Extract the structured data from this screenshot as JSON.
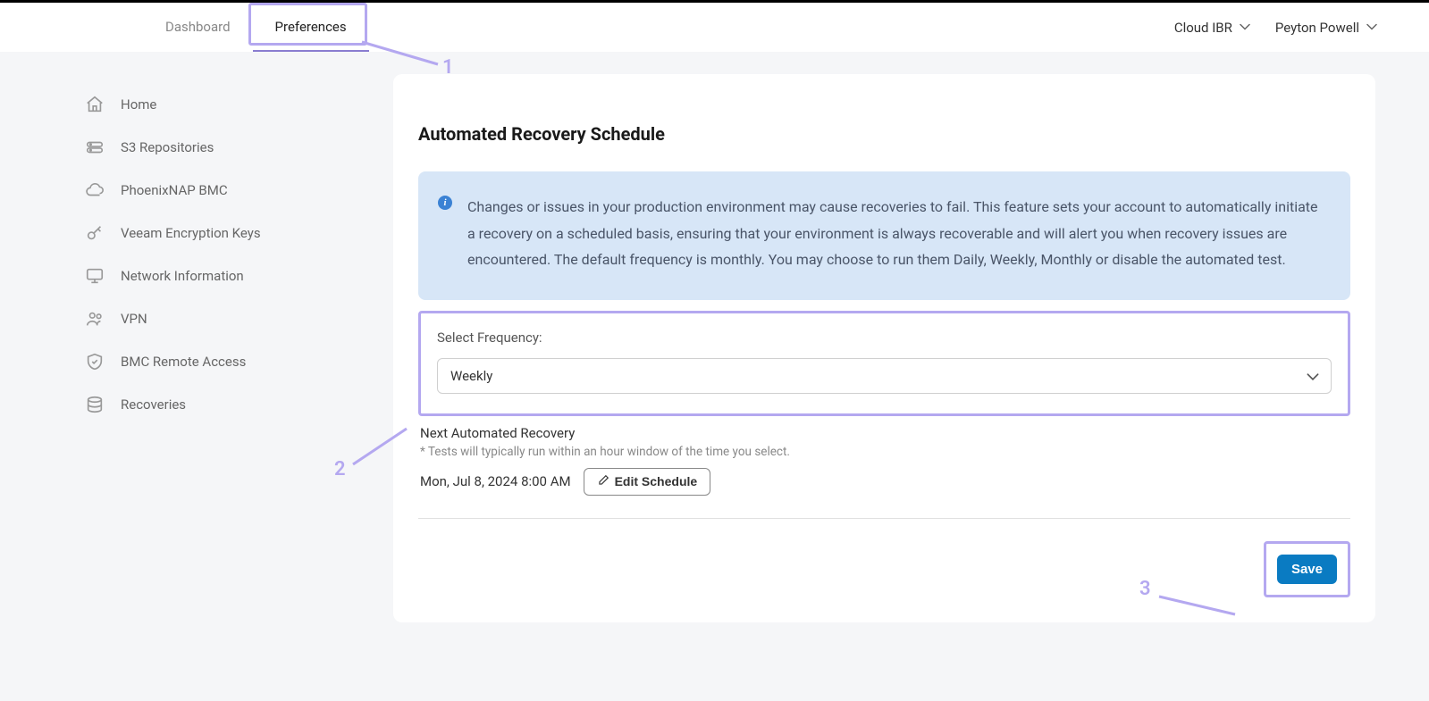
{
  "topbar": {
    "tabs": [
      {
        "label": "Dashboard",
        "active": false
      },
      {
        "label": "Preferences",
        "active": true
      }
    ],
    "right_menus": [
      {
        "label": "Cloud IBR"
      },
      {
        "label": "Peyton Powell"
      }
    ]
  },
  "sidebar": {
    "items": [
      {
        "label": "Home",
        "icon": "home"
      },
      {
        "label": "S3 Repositories",
        "icon": "storage"
      },
      {
        "label": "PhoenixNAP BMC",
        "icon": "cloud"
      },
      {
        "label": "Veeam Encryption Keys",
        "icon": "key"
      },
      {
        "label": "Network Information",
        "icon": "monitor"
      },
      {
        "label": "VPN",
        "icon": "users"
      },
      {
        "label": "BMC Remote Access",
        "icon": "shield"
      },
      {
        "label": "Recoveries",
        "icon": "database"
      }
    ]
  },
  "content": {
    "title": "Automated Recovery Schedule",
    "info_text": "Changes or issues in your production environment may cause recoveries to fail. This feature sets your account to automatically initiate a recovery on a scheduled basis, ensuring that your environment is always recoverable and will alert you when recovery issues are encountered. The default frequency is monthly. You may choose to run them Daily, Weekly, Monthly or disable the automated test.",
    "frequency_label": "Select Frequency:",
    "frequency_value": "Weekly",
    "next_recovery_label": "Next Automated Recovery",
    "next_recovery_note": "* Tests will typically run within an hour window of the time you select.",
    "next_recovery_date": "Mon, Jul 8, 2024 8:00 AM",
    "edit_schedule_label": "Edit Schedule",
    "save_label": "Save"
  },
  "annotations": {
    "n1": "1",
    "n2": "2",
    "n3": "3"
  }
}
